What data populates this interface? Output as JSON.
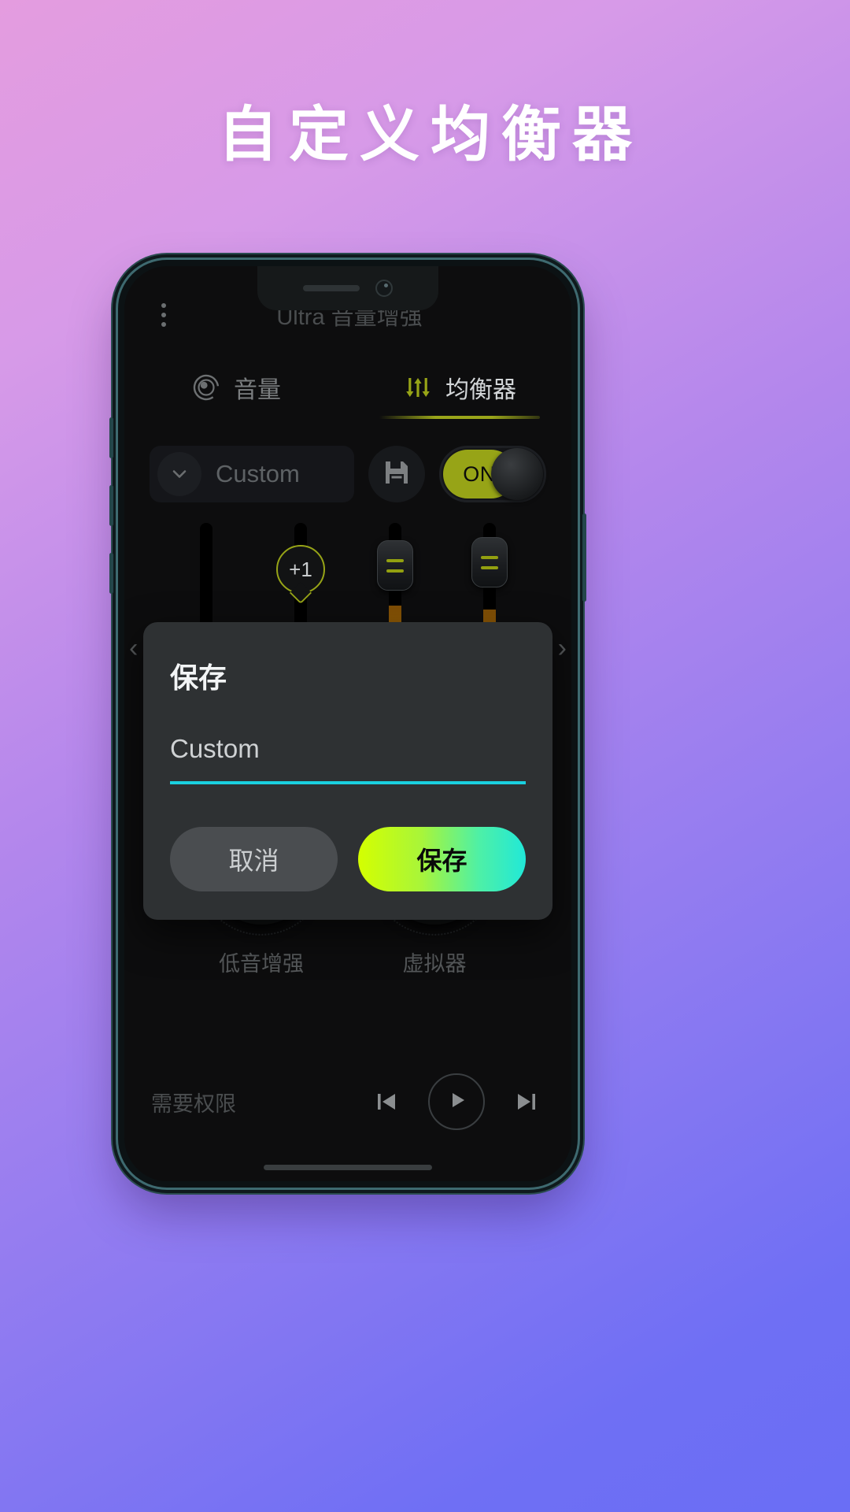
{
  "headline": "自定义均衡器",
  "colors": {
    "accent_olive": "#97a417",
    "accent_cyan": "#1ad0e0",
    "gradient_start": "#d4ff00",
    "gradient_end": "#21e8d8",
    "screen_bg": "#0d0d0e",
    "dialog_bg": "#2e3133"
  },
  "app": {
    "title": "Ultra 音量增强",
    "menu_icon": "kebab-menu-icon"
  },
  "tabs": [
    {
      "label": "音量",
      "icon": "volume-dial-icon",
      "active": false
    },
    {
      "label": "均衡器",
      "icon": "equalizer-sliders-icon",
      "active": true
    }
  ],
  "preset_row": {
    "chevron_icon": "chevron-down-icon",
    "preset_name": "Custom",
    "save_icon": "floppy-save-icon",
    "toggle_label": "ON",
    "toggle_state": "on"
  },
  "equalizer": {
    "tooltip_value": "+1",
    "scroll_left_icon": "chevron-left-icon",
    "scroll_right_icon": "chevron-right-icon",
    "bands": [
      {
        "gain": 0,
        "fill_pct": 0,
        "thumb_pct": 92,
        "active": false,
        "tooltip": null
      },
      {
        "gain": 1,
        "fill_pct": 0,
        "thumb_pct": 88,
        "active": false,
        "tooltip": "+1"
      },
      {
        "gain": 9,
        "fill_pct": 62,
        "thumb_pct": 12,
        "active": true,
        "tooltip": null
      },
      {
        "gain": 9,
        "fill_pct": 60,
        "thumb_pct": 10,
        "active": true,
        "tooltip": null
      }
    ]
  },
  "knobs": [
    {
      "label": "低音增强"
    },
    {
      "label": "虚拟器"
    }
  ],
  "bottom_bar": {
    "permission_text": "需要权限",
    "prev_icon": "skip-previous-icon",
    "play_icon": "play-icon",
    "next_icon": "skip-next-icon"
  },
  "dialog": {
    "title": "保存",
    "input_value": "Custom",
    "input_placeholder": "Custom",
    "cancel_label": "取消",
    "confirm_label": "保存"
  }
}
